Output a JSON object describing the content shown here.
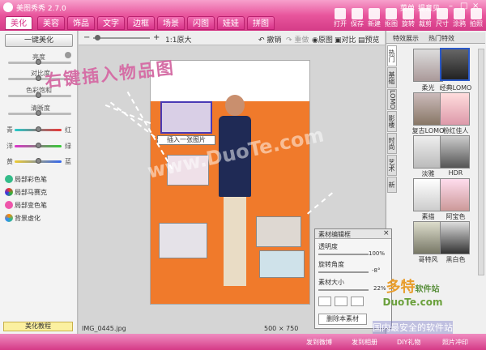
{
  "app": {
    "title": "美图秀秀 2.7.0",
    "menu": "菜单",
    "feedback": "提意见",
    "logo_icon": "meitu-logo-icon"
  },
  "tabs": [
    {
      "label": "美化",
      "active": true
    },
    {
      "label": "美容"
    },
    {
      "label": "饰品"
    },
    {
      "label": "文字"
    },
    {
      "label": "边框"
    },
    {
      "label": "场景"
    },
    {
      "label": "闪图"
    },
    {
      "label": "娃娃"
    },
    {
      "label": "拼图"
    }
  ],
  "toolbar": [
    {
      "label": "打开"
    },
    {
      "label": "保存"
    },
    {
      "label": "新建"
    },
    {
      "label": "抠图"
    },
    {
      "label": "旋转"
    },
    {
      "label": "裁剪"
    },
    {
      "label": "尺寸"
    },
    {
      "label": "涂鸦"
    },
    {
      "label": "拍照"
    }
  ],
  "left": {
    "one_click": "一键美化",
    "sliders": [
      {
        "label": "亮度"
      },
      {
        "label": "对比度"
      },
      {
        "label": "色彩饱和"
      },
      {
        "label": "清晰度"
      }
    ],
    "color_sliders": [
      {
        "left": "青",
        "right": "红"
      },
      {
        "left": "洋",
        "right": "绿"
      },
      {
        "left": "黄",
        "right": "蓝"
      }
    ],
    "local": [
      {
        "label": "局部彩色笔"
      },
      {
        "label": "局部马赛克"
      },
      {
        "label": "局部变色笔"
      },
      {
        "label": "背景虚化"
      }
    ],
    "tutorial": "美化教程"
  },
  "topbar": {
    "zoom": "1:1原大",
    "undo": "撤销",
    "redo": "重做",
    "original": "原图",
    "compare": "对比",
    "preview": "预览"
  },
  "annotation": "右键插入物品图",
  "insert_label": "插入一张图片",
  "watermark": "www.DuoTe.com",
  "status": {
    "filename": "IMG_0445.jpg",
    "dimensions": "500 × 750"
  },
  "right": {
    "tabs": [
      "特效展示",
      "热门特效"
    ],
    "vtabs": [
      "热门",
      "基础",
      "LOMO",
      "影楼",
      "时尚",
      "艺术",
      "新"
    ],
    "effects": [
      "柔光",
      "经典LOMO",
      "复古LOMO",
      "粉红佳人",
      "淡雅",
      "HDR",
      "素描",
      "阿宝色",
      "哥特风",
      "黑白色"
    ]
  },
  "material": {
    "title": "素材编辑框",
    "opacity": "透明度",
    "opacity_val": "100%",
    "rotation": "旋转角度",
    "rotation_val": "-8°",
    "size": "素材大小",
    "size_val": "22%",
    "delete": "删除本素材"
  },
  "brand": {
    "name": "多特",
    "sub": "软件站",
    "url": "DuoTe.com",
    "slogan": "国内最安全的软件站"
  },
  "bottom": [
    {
      "label": "发到微博"
    },
    {
      "label": "发到相册"
    },
    {
      "label": "DIY礼物"
    },
    {
      "label": "照片冲印"
    }
  ]
}
